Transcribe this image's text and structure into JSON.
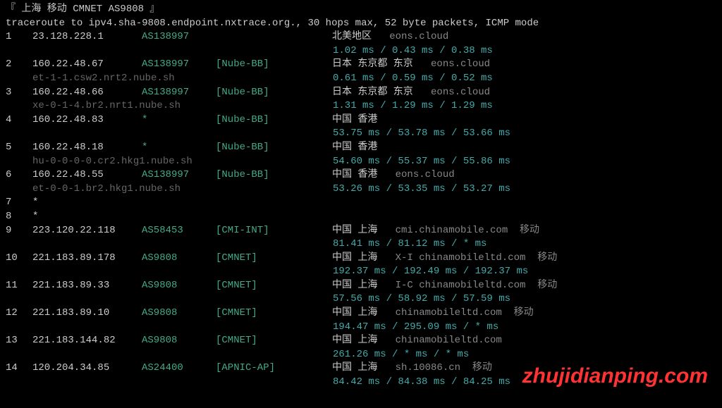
{
  "header": "『 上海 移动 CMNET AS9808 』",
  "cmd": "traceroute to ipv4.sha-9808.endpoint.nxtrace.org., 30 hops max, 52 byte packets, ICMP mode",
  "watermark": "zhujidianping.com",
  "hops": [
    {
      "n": "1",
      "ip": "23.128.228.1",
      "asn": "AS138997",
      "tag": "",
      "loc": "北美地区",
      "host": "eons.cloud",
      "carrier": "",
      "rdns": "",
      "timings": "1.02 ms / 0.43 ms / 0.38 ms"
    },
    {
      "n": "2",
      "ip": "160.22.48.67",
      "asn": "AS138997",
      "tag": "[Nube-BB]",
      "loc": "日本 东京都 东京",
      "host": "eons.cloud",
      "carrier": "",
      "rdns": "et-1-1.csw2.nrt2.nube.sh",
      "timings": "0.61 ms / 0.59 ms / 0.52 ms"
    },
    {
      "n": "3",
      "ip": "160.22.48.66",
      "asn": "AS138997",
      "tag": "[Nube-BB]",
      "loc": "日本 东京都 东京",
      "host": "eons.cloud",
      "carrier": "",
      "rdns": "xe-0-1-4.br2.nrt1.nube.sh",
      "timings": "1.31 ms / 1.29 ms / 1.29 ms"
    },
    {
      "n": "4",
      "ip": "160.22.48.83",
      "asn": "*",
      "tag": "[Nube-BB]",
      "loc": "中国 香港",
      "host": "",
      "carrier": "",
      "rdns": "",
      "timings": "53.75 ms / 53.78 ms / 53.66 ms"
    },
    {
      "n": "5",
      "ip": "160.22.48.18",
      "asn": "*",
      "tag": "[Nube-BB]",
      "loc": "中国 香港",
      "host": "",
      "carrier": "",
      "rdns": "hu-0-0-0-0.cr2.hkg1.nube.sh",
      "timings": "54.60 ms / 55.37 ms / 55.86 ms"
    },
    {
      "n": "6",
      "ip": "160.22.48.55",
      "asn": "AS138997",
      "tag": "[Nube-BB]",
      "loc": "中国 香港",
      "host": "eons.cloud",
      "carrier": "",
      "rdns": "et-0-0-1.br2.hkg1.nube.sh",
      "timings": "53.26 ms / 53.35 ms / 53.27 ms"
    },
    {
      "n": "7",
      "ip": "*",
      "asn": "",
      "tag": "",
      "loc": "",
      "host": "",
      "carrier": "",
      "rdns": "",
      "timings": ""
    },
    {
      "n": "8",
      "ip": "*",
      "asn": "",
      "tag": "",
      "loc": "",
      "host": "",
      "carrier": "",
      "rdns": "",
      "timings": ""
    },
    {
      "n": "9",
      "ip": "223.120.22.118",
      "asn": "AS58453",
      "tag": "[CMI-INT]",
      "loc": "中国 上海",
      "host": "cmi.chinamobile.com",
      "carrier": "移动",
      "rdns": "",
      "timings": "81.41 ms / 81.12 ms / * ms"
    },
    {
      "n": "10",
      "ip": "221.183.89.178",
      "asn": "AS9808",
      "tag": "[CMNET]",
      "loc": "中国 上海",
      "host": "X-I chinamobileltd.com",
      "carrier": "移动",
      "rdns": "",
      "timings": "192.37 ms / 192.49 ms / 192.37 ms"
    },
    {
      "n": "11",
      "ip": "221.183.89.33",
      "asn": "AS9808",
      "tag": "[CMNET]",
      "loc": "中国 上海",
      "host": "I-C chinamobileltd.com",
      "carrier": "移动",
      "rdns": "",
      "timings": "57.56 ms / 58.92 ms / 57.59 ms"
    },
    {
      "n": "12",
      "ip": "221.183.89.10",
      "asn": "AS9808",
      "tag": "[CMNET]",
      "loc": "中国 上海",
      "host": "chinamobileltd.com",
      "carrier": "移动",
      "rdns": "",
      "timings": "194.47 ms / 295.09 ms / * ms"
    },
    {
      "n": "13",
      "ip": "221.183.144.82",
      "asn": "AS9808",
      "tag": "[CMNET]",
      "loc": "中国 上海",
      "host": "chinamobileltd.com",
      "carrier": "",
      "rdns": "",
      "timings": "261.26 ms / * ms / * ms"
    },
    {
      "n": "14",
      "ip": "120.204.34.85",
      "asn": "AS24400",
      "tag": "[APNIC-AP]",
      "loc": "中国 上海",
      "host": "sh.10086.cn",
      "carrier": "移动",
      "rdns": "",
      "timings": "84.42 ms / 84.38 ms / 84.25 ms"
    }
  ]
}
